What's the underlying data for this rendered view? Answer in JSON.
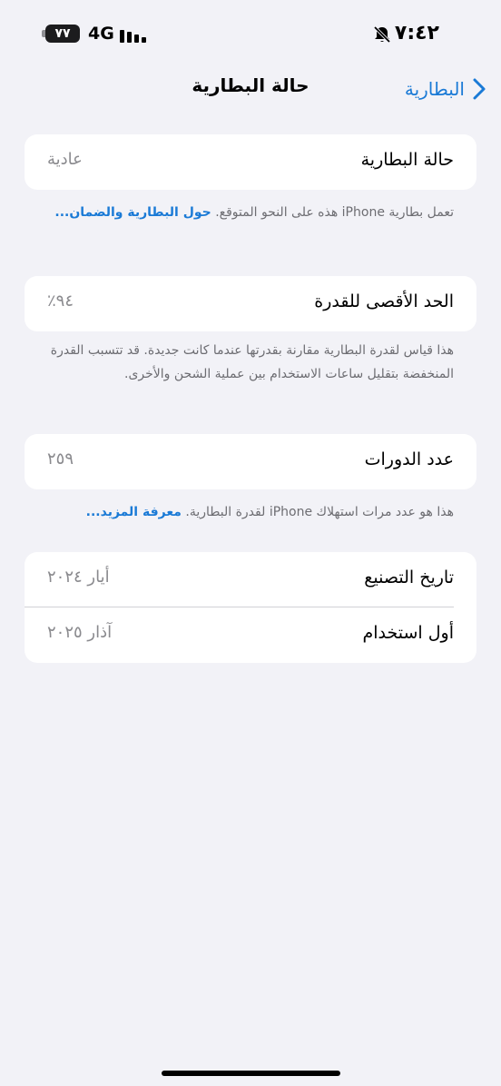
{
  "status_bar": {
    "time": "٧:٤٢",
    "battery_level": "٧٧",
    "network": "4G"
  },
  "nav": {
    "title": "حالة البطارية",
    "back_label": "البطارية"
  },
  "health_card": {
    "label": "حالة البطارية",
    "value": "عادية"
  },
  "health_note": {
    "text": "تعمل بطارية iPhone هذه على النحو المتوقع.",
    "link": "حول البطارية والضمان..."
  },
  "capacity_card": {
    "label": "الحد الأقصى للقدرة",
    "value": "٩٤٪"
  },
  "capacity_note": {
    "text": "هذا قياس لقدرة البطارية مقارنة بقدرتها عندما كانت جديدة. قد تتسبب القدرة المنخفضة بتقليل ساعات الاستخدام بين عملية الشحن والأخرى."
  },
  "cycles_card": {
    "label": "عدد الدورات",
    "value": "٢٥٩"
  },
  "cycles_note": {
    "text": "هذا هو عدد مرات استهلاك iPhone لقدرة البطارية.",
    "link": "معرفة المزيد..."
  },
  "dates_card": {
    "manufacture_label": "تاريخ التصنيع",
    "manufacture_value": "أيار ٢٠٢٤",
    "first_use_label": "أول استخدام",
    "first_use_value": "آذار ٢٠٢٥"
  },
  "colors": {
    "accent": "#1a7ad6",
    "background": "#f2f2f7",
    "secondary_text": "#8a8a8e"
  }
}
